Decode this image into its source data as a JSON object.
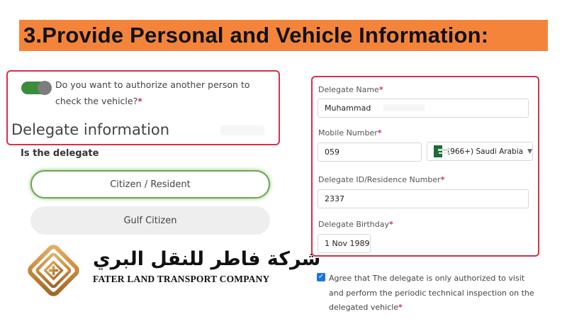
{
  "banner": {
    "title": "3.Provide Personal and Vehicle Information:"
  },
  "authorization": {
    "question": "Do you want to authorize another person to check the vehicle?",
    "required_mark": "*",
    "section_title": "Delegate information",
    "toggle_on": true
  },
  "delegate_type": {
    "label": "Is the delegate",
    "options": [
      "Citizen / Resident",
      "Gulf Citizen"
    ],
    "selected": "Citizen / Resident"
  },
  "company": {
    "name_arabic": "شركة فاطر للنقل البري",
    "name_english": "FATER LAND TRANSPORT COMPANY"
  },
  "form": {
    "delegate_name": {
      "label": "Delegate Name",
      "value": "Muhammad"
    },
    "mobile_number": {
      "label": "Mobile Number",
      "value": "059",
      "country": "(966+) Saudi Arabia"
    },
    "delegate_id": {
      "label": "Delegate ID/Residence Number",
      "value": "2337"
    },
    "birthday": {
      "label": "Delegate Birthday",
      "value": "1 Nov 1989"
    },
    "required_mark": "*"
  },
  "agreement": {
    "checked": true,
    "text": "Agree that The delegate is only authorized to visit and perform the periodic technical inspection on the delegated vehicle",
    "required_mark": "*"
  },
  "colors": {
    "banner": "#f5843b",
    "highlight_border": "#d6314a",
    "toggle": "#3d8b3d",
    "logo_gold": "#c8893a"
  }
}
